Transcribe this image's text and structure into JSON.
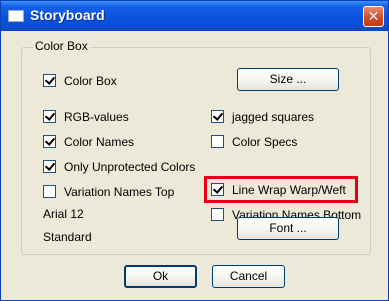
{
  "window": {
    "title": "Storyboard",
    "close_label": "✕"
  },
  "group": {
    "label": "Color Box"
  },
  "checkboxes": {
    "color_box": {
      "label": "Color Box",
      "checked": true
    },
    "rgb_values": {
      "label": "RGB-values",
      "checked": true
    },
    "jagged_squares": {
      "label": "jagged squares",
      "checked": true
    },
    "color_names": {
      "label": "Color Names",
      "checked": true
    },
    "color_specs": {
      "label": "Color Specs",
      "checked": false
    },
    "only_unprotected": {
      "label": "Only Unprotected Colors",
      "checked": true
    },
    "line_wrap": {
      "label": "Line Wrap Warp/Weft",
      "checked": true
    },
    "var_names_top": {
      "label": "Variation Names Top",
      "checked": false
    },
    "var_names_bottom": {
      "label": "Variation Names Bottom",
      "checked": false
    }
  },
  "font_info": {
    "font_name": "Arial 12",
    "font_style": "Standard"
  },
  "buttons": {
    "size": "Size ...",
    "font": "Font ...",
    "ok": "Ok",
    "cancel": "Cancel"
  },
  "colors": {
    "highlight": "#e4001b",
    "titlebar": "#0a53e0"
  }
}
